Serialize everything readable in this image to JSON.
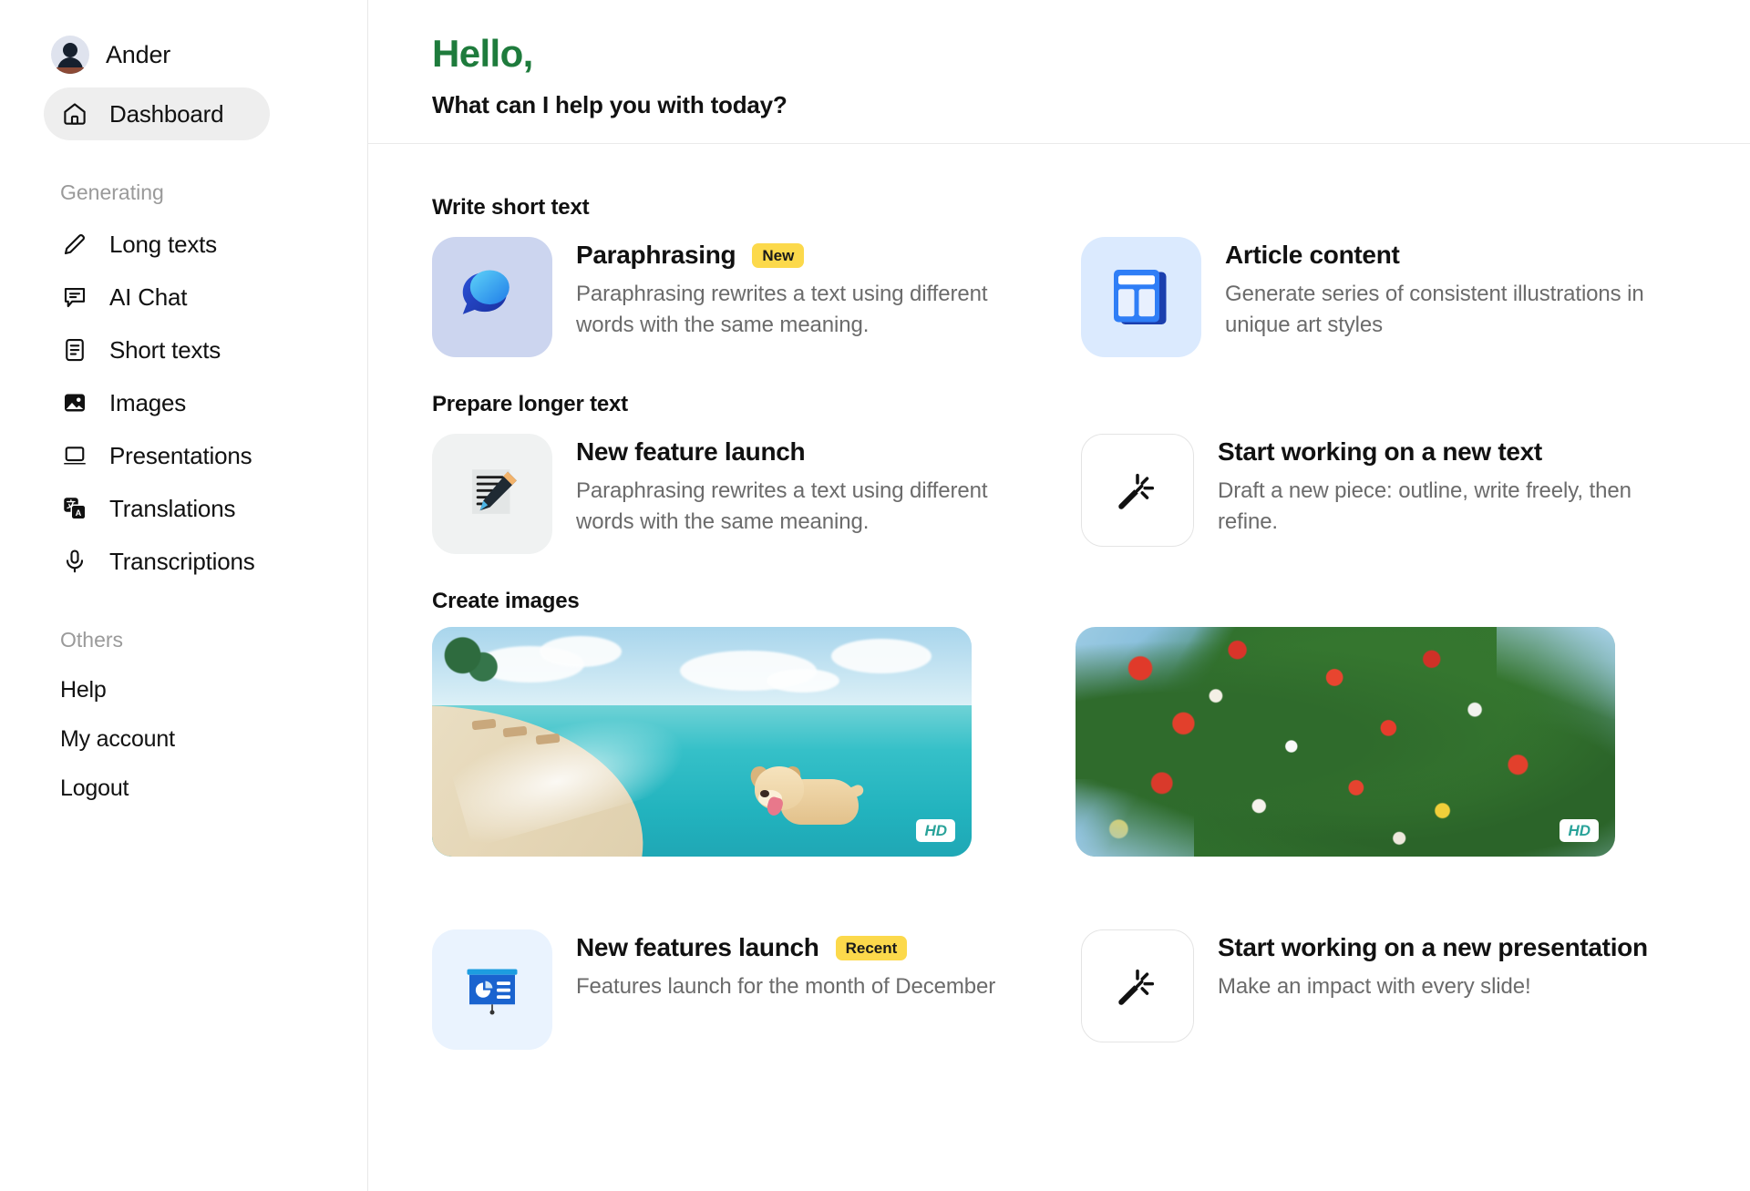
{
  "sidebar": {
    "user": {
      "name": "Ander",
      "avatar_icon": "user-avatar"
    },
    "dashboard": {
      "label": "Dashboard",
      "icon": "home-icon",
      "active": true
    },
    "generating_label": "Generating",
    "generating_items": [
      {
        "label": "Long texts",
        "icon": "pencil-icon"
      },
      {
        "label": "AI Chat",
        "icon": "chat-bubble-icon"
      },
      {
        "label": "Short texts",
        "icon": "document-lines-icon"
      },
      {
        "label": "Images",
        "icon": "image-icon"
      },
      {
        "label": "Presentations",
        "icon": "laptop-icon"
      },
      {
        "label": "Translations",
        "icon": "translate-icon"
      },
      {
        "label": "Transcriptions",
        "icon": "microphone-icon"
      }
    ],
    "others_label": "Others",
    "others_items": [
      {
        "label": "Help"
      },
      {
        "label": "My account"
      },
      {
        "label": "Logout"
      }
    ]
  },
  "header": {
    "greeting": "Hello,",
    "greeting_color": "#1e7b3c",
    "subtitle": "What can I help you with today?"
  },
  "sections": {
    "write_short_text": {
      "title": "Write short text",
      "cards": [
        {
          "title": "Paraphrasing",
          "badge": "New",
          "badge_color": "#fcd94b",
          "description": "Paraphrasing rewrites a text using different words with the same meaning.",
          "icon": "speech-bubbles-icon",
          "thumb_style": "lav"
        },
        {
          "title": "Article content",
          "description": "Generate series of consistent illustrations in unique art styles",
          "icon": "article-layout-icon",
          "thumb_style": "skyblue"
        }
      ]
    },
    "prepare_longer_text": {
      "title": "Prepare longer text",
      "cards": [
        {
          "title": "New feature launch",
          "description": "Paraphrasing rewrites a text using different words with the same meaning.",
          "icon": "memo-pencil-icon",
          "thumb_style": "grey"
        },
        {
          "title": "Start working on a new text",
          "description": "Draft a new piece: outline, write freely, then refine.",
          "icon": "magic-wand-icon",
          "thumb_style": "outline"
        }
      ]
    },
    "create_images": {
      "title": "Create images",
      "images": [
        {
          "name": "beach-dog-image",
          "badge": "HD",
          "scene": "beach"
        },
        {
          "name": "flower-wall-image",
          "badge": "HD",
          "scene": "flowers"
        }
      ]
    },
    "bottom": {
      "cards": [
        {
          "title": "New features launch",
          "badge": "Recent",
          "badge_color": "#fcd94b",
          "description": "Features launch for the month of December",
          "icon": "presentation-chart-icon",
          "thumb_style": "paleblue"
        },
        {
          "title": "Start working on a new presentation",
          "description": "Make an impact with every slide!",
          "icon": "magic-wand-icon",
          "thumb_style": "outline"
        }
      ]
    }
  }
}
